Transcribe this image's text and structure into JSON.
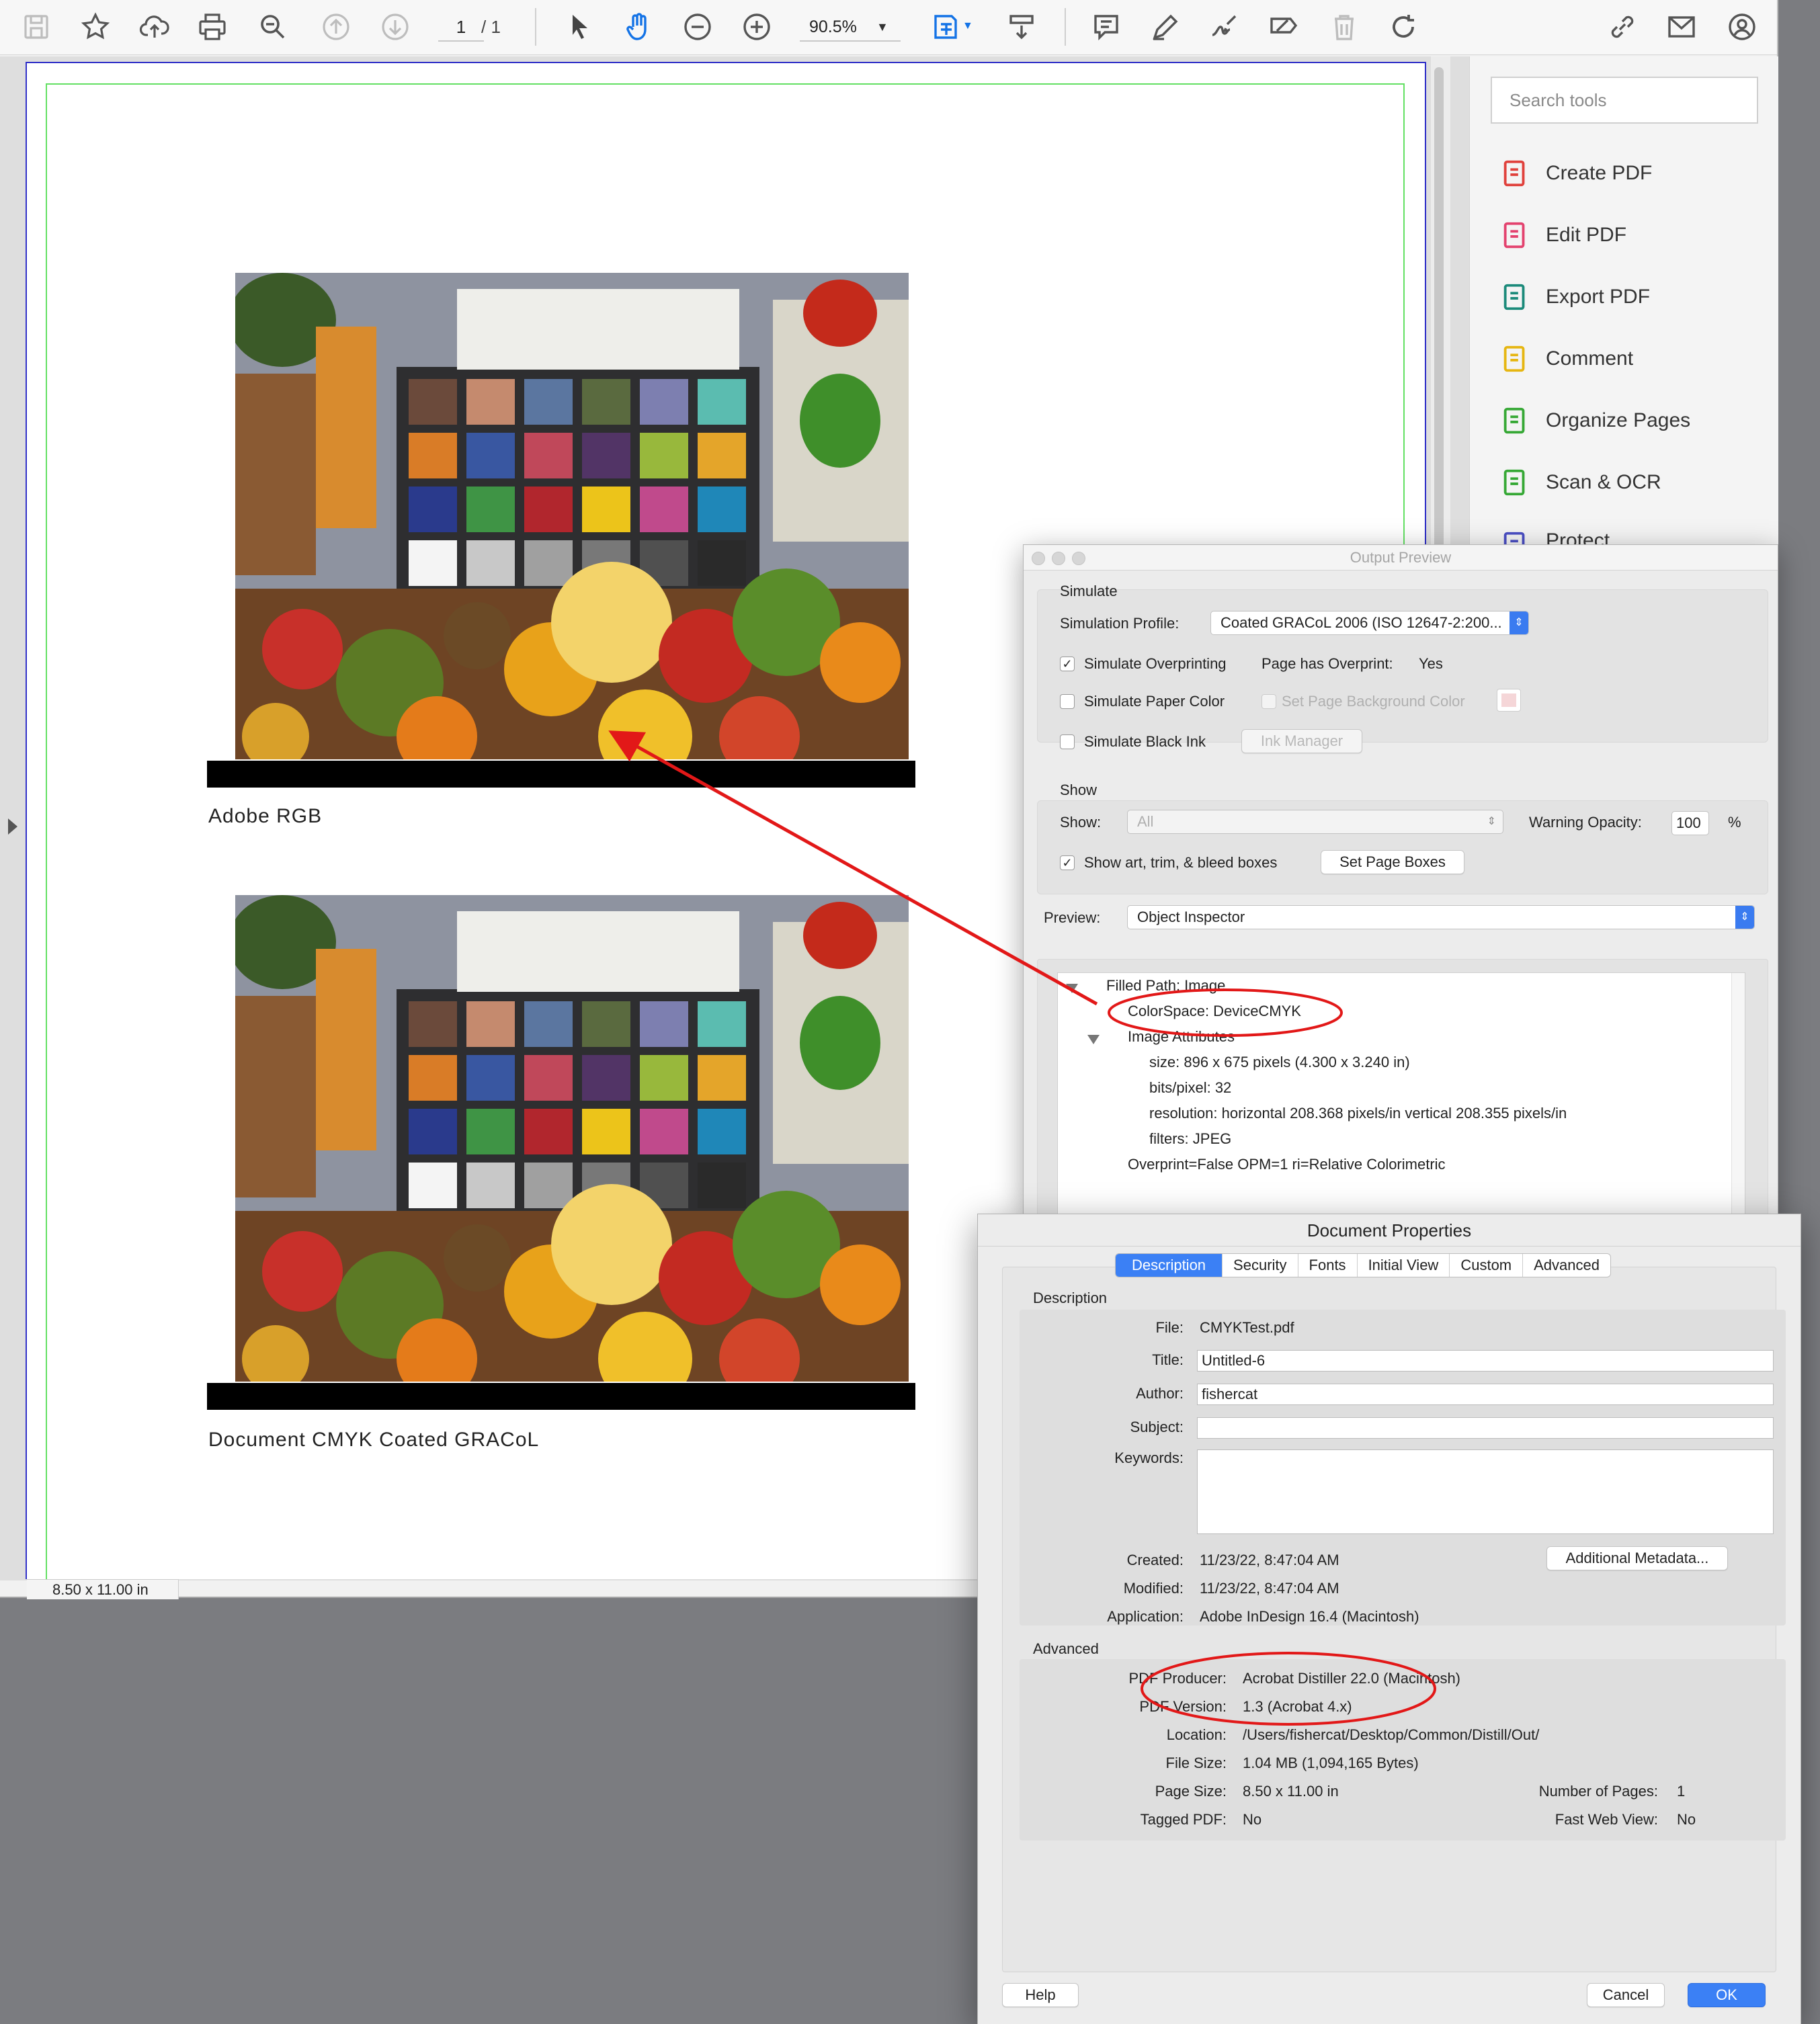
{
  "toolbar": {
    "page_current": "1",
    "page_total": "/ 1",
    "zoom": "90.5%",
    "icons": [
      "save-icon",
      "bookmark-star-icon",
      "upload-cloud-icon",
      "print-icon",
      "find-icon",
      "page-up-icon",
      "page-down-icon",
      "select-arrow-icon",
      "hand-icon",
      "zoom-out-icon",
      "zoom-in-icon",
      "fit-page-icon",
      "scroll-mode-icon",
      "comment-icon",
      "pen-icon",
      "sign-icon",
      "fill-sign-icon",
      "delete-icon",
      "rotate-icon",
      "share-link-icon",
      "email-icon",
      "account-icon"
    ]
  },
  "document": {
    "captions": [
      "Adobe RGB",
      "Document CMYK Coated GRACoL"
    ],
    "page_size": "8.50 x 11.00 in"
  },
  "tools_pane": {
    "search_placeholder": "Search tools",
    "items": [
      {
        "label": "Create PDF",
        "icon": "create-pdf-icon",
        "color": "#e0413c"
      },
      {
        "label": "Edit PDF",
        "icon": "edit-pdf-icon",
        "color": "#e3426e"
      },
      {
        "label": "Export PDF",
        "icon": "export-pdf-icon",
        "color": "#1b8a7a"
      },
      {
        "label": "Comment",
        "icon": "comment-icon",
        "color": "#e6b611"
      },
      {
        "label": "Organize Pages",
        "icon": "organize-pages-icon",
        "color": "#36a835"
      },
      {
        "label": "Scan & OCR",
        "icon": "scan-icon",
        "color": "#36a835"
      },
      {
        "label": "Protect",
        "icon": "protect-icon",
        "color": "#4b4fc4"
      }
    ]
  },
  "output_preview": {
    "title": "Output Preview",
    "simulate_heading": "Simulate",
    "simulation_profile_label": "Simulation Profile:",
    "simulation_profile_value": "Coated GRACoL 2006 (ISO 12647-2:200...",
    "simulate_overprinting": "Simulate Overprinting",
    "page_has_overprint_label": "Page has Overprint:",
    "page_has_overprint_value": "Yes",
    "simulate_paper_color": "Simulate Paper Color",
    "set_page_bg": "Set Page Background Color",
    "simulate_black_ink": "Simulate Black Ink",
    "ink_manager": "Ink Manager",
    "show_heading": "Show",
    "show_label": "Show:",
    "show_value": "All",
    "warning_opacity_label": "Warning Opacity:",
    "warning_opacity_value": "100",
    "percent": "%",
    "show_boxes": "Show art, trim, & bleed boxes",
    "set_page_boxes": "Set Page Boxes",
    "preview_label": "Preview:",
    "preview_value": "Object Inspector",
    "tree": [
      "Filled Path: Image",
      "ColorSpace: DeviceCMYK",
      "Image Attributes",
      "size: 896 x 675 pixels (4.300 x 3.240 in)",
      "bits/pixel: 32",
      "resolution: horizontal 208.368 pixels/in vertical 208.355 pixels/in",
      "filters: JPEG",
      "Overprint=False OPM=1 ri=Relative Colorimetric"
    ]
  },
  "doc_props": {
    "title": "Document Properties",
    "tabs": [
      "Description",
      "Security",
      "Fonts",
      "Initial View",
      "Custom",
      "Advanced"
    ],
    "description_heading": "Description",
    "file_label": "File:",
    "file_value": "CMYKTest.pdf",
    "title_label": "Title:",
    "title_value": "Untitled-6",
    "author_label": "Author:",
    "author_value": "fishercat",
    "subject_label": "Subject:",
    "subject_value": "",
    "keywords_label": "Keywords:",
    "keywords_value": "",
    "created_label": "Created:",
    "created_value": "11/23/22, 8:47:04 AM",
    "modified_label": "Modified:",
    "modified_value": "11/23/22, 8:47:04 AM",
    "application_label": "Application:",
    "application_value": "Adobe InDesign 16.4 (Macintosh)",
    "additional_metadata": "Additional Metadata...",
    "advanced_heading": "Advanced",
    "producer_label": "PDF Producer:",
    "producer_value": "Acrobat Distiller 22.0 (Macintosh)",
    "version_label": "PDF Version:",
    "version_value": "1.3 (Acrobat 4.x)",
    "location_label": "Location:",
    "location_value": "/Users/fishercat/Desktop/Common/Distill/Out/",
    "filesize_label": "File Size:",
    "filesize_value": "1.04 MB (1,094,165 Bytes)",
    "pagesize_label": "Page Size:",
    "pagesize_value": "8.50 x 11.00 in",
    "numpages_label": "Number of Pages:",
    "numpages_value": "1",
    "tagged_label": "Tagged PDF:",
    "tagged_value": "No",
    "fastweb_label": "Fast Web View:",
    "fastweb_value": "No",
    "help": "Help",
    "cancel": "Cancel",
    "ok": "OK"
  },
  "colors": {
    "accent": "#3b80f5",
    "annotation_red": "#e21818",
    "trim_green": "#63e063",
    "media_blue": "#3030c8"
  }
}
